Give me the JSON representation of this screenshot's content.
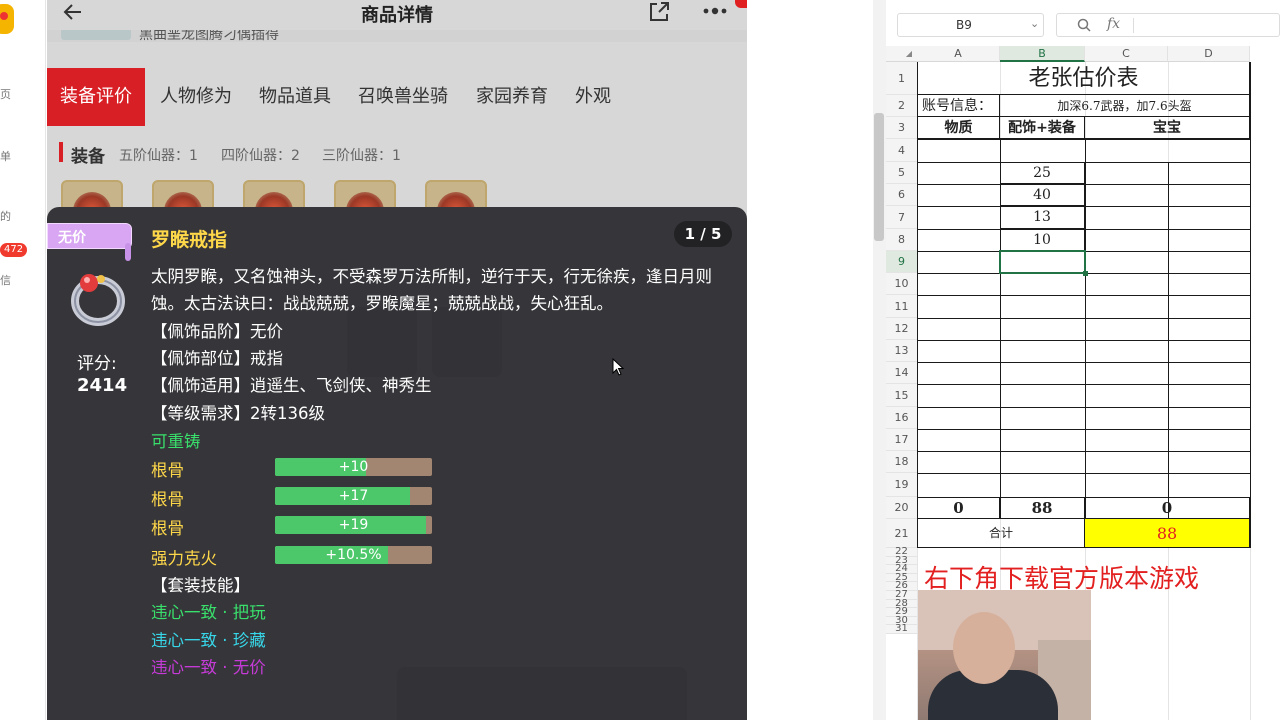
{
  "left_strip": {
    "texts": [
      "页",
      "单",
      "的",
      "信"
    ],
    "badge": "472"
  },
  "header": {
    "title": "商品详情",
    "sub_text": "黑曲垩龙图腾刁偶插得"
  },
  "tabs": [
    "装备评价",
    "人物修为",
    "物品道具",
    "召唤兽坐骑",
    "家园养育",
    "外观"
  ],
  "equipment": {
    "title": "装备",
    "stats": [
      "五阶仙器：1",
      "四阶仙器：2",
      "三阶仙器：1"
    ]
  },
  "tooltip": {
    "badge": "无价",
    "name": "罗睺戒指",
    "pager": "1 / 5",
    "score_label": "评分:",
    "score_value": "2414",
    "description": "太阴罗睺，又名蚀神头，不受森罗万法所制，逆行于天，行无徐疾，逢日月则蚀。太古法诀曰：战战兢兢，罗睺魔星；兢兢战战，失心狂乱。",
    "attributes": [
      "【佩饰品阶】无价",
      "【佩饰部位】戒指",
      "【佩饰适用】逍遥生、飞剑侠、神秀生",
      "【等级需求】2转136级"
    ],
    "recast": "可重铸",
    "stats": [
      {
        "label": "根骨",
        "value": "+10",
        "fill": 0.58
      },
      {
        "label": "根骨",
        "value": "+17",
        "fill": 0.86
      },
      {
        "label": "根骨",
        "value": "+19",
        "fill": 0.96
      },
      {
        "label": "强力克火",
        "value": "+10.5%",
        "fill": 0.72
      }
    ],
    "set_title": "【套装技能】",
    "set_skills": [
      {
        "text": "违心一致 · 把玩",
        "color": "#39e06c"
      },
      {
        "text": "违心一致 · 珍藏",
        "color": "#37d6e8"
      },
      {
        "text": "违心一致 · 无价",
        "color": "#c63bd8"
      }
    ]
  },
  "sheet": {
    "namebox": "B9",
    "fx_label": "fx",
    "columns": [
      "A",
      "B",
      "C",
      "D"
    ],
    "title": "老张估价表",
    "account_label": "账号信息：",
    "account_value": "加深6.7武器，加7.6头盔",
    "col_headers": [
      "物质",
      "配饰+装备",
      "宝宝"
    ],
    "b_values": [
      "25",
      "40",
      "13",
      "10"
    ],
    "row20": [
      "0",
      "88",
      "0"
    ],
    "total_label": "合计",
    "total_value": "88",
    "total_bg": "#ffff00",
    "total_color": "#e32020",
    "promo": "右下角下载官方版本游戏"
  }
}
